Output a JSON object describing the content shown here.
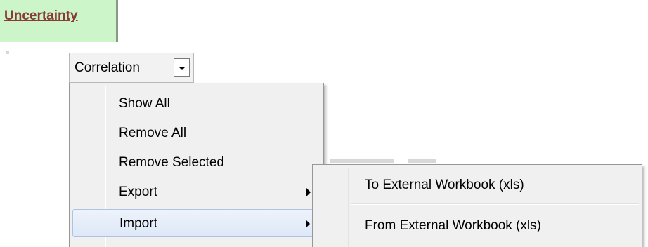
{
  "tab": {
    "label": "Uncertainty"
  },
  "correlation": {
    "label": "Correlation"
  },
  "menu": {
    "items": [
      {
        "label": "Show All",
        "has_submenu": false
      },
      {
        "label": "Remove All",
        "has_submenu": false
      },
      {
        "label": "Remove Selected",
        "has_submenu": false
      },
      {
        "label": "Export",
        "has_submenu": true
      },
      {
        "label": "Import",
        "has_submenu": true,
        "highlighted": true
      }
    ]
  },
  "submenu": {
    "items": [
      {
        "label": "To External Workbook (xls)"
      },
      {
        "label": "From External Workbook (xls)"
      }
    ]
  },
  "colors": {
    "tab_bg": "#ccf5c9",
    "link_color": "#8b3a3a",
    "menu_bg": "#f0f0f0",
    "highlight_border": "#aec3e3"
  }
}
